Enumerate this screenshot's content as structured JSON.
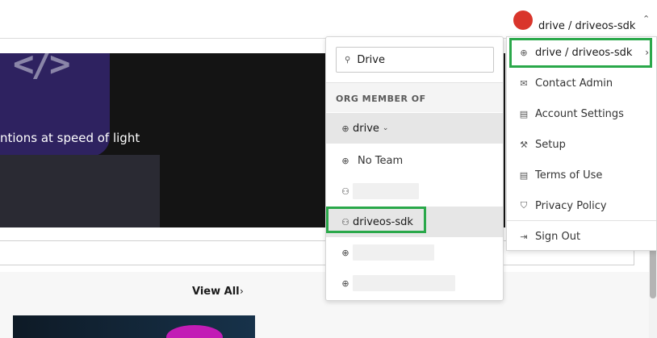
{
  "header": {
    "user_label": "drive / driveos-sdk",
    "avatar_color": "#d9352b"
  },
  "hero": {
    "tile_glyph": "</>",
    "headline": "ntions at speed of light"
  },
  "section": {
    "view_all": "View All",
    "view_all_chevron": "›"
  },
  "org_menu": {
    "search_icon": "filter-icon",
    "search_value": "Drive",
    "heading": "ORG MEMBER OF",
    "items": [
      {
        "icon": "globe-icon",
        "label": "drive",
        "active": true
      },
      {
        "icon": "globe-icon",
        "label": "No Team"
      },
      {
        "icon": "team-icon",
        "label": ""
      },
      {
        "icon": "team-icon",
        "label": "driveos-sdk",
        "active": true
      },
      {
        "icon": "globe-icon",
        "label": ""
      },
      {
        "icon": "globe-icon",
        "label": ""
      }
    ]
  },
  "account_menu": {
    "items": [
      {
        "icon": "globe-icon",
        "label": "drive / driveos-sdk",
        "submenu": true
      },
      {
        "icon": "mail-icon",
        "label": "Contact Admin"
      },
      {
        "icon": "clipboard-icon",
        "label": "Account Settings"
      },
      {
        "icon": "wrench-icon",
        "label": "Setup"
      },
      {
        "icon": "clipboard-icon",
        "label": "Terms of Use"
      },
      {
        "icon": "shield-icon",
        "label": "Privacy Policy"
      },
      {
        "icon": "sign-out-icon",
        "label": "Sign Out"
      }
    ]
  },
  "colors": {
    "highlight": "#2aa84a",
    "hero_bg": "#141414",
    "hero_tile": "#2e2260"
  }
}
